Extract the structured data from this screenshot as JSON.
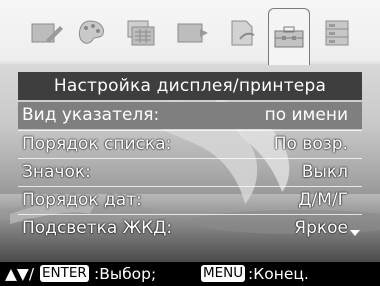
{
  "menu": {
    "title": "Настройка дисплея/принтера",
    "items": [
      {
        "label": "Вид указателя:",
        "value": "по имени"
      },
      {
        "label": "Порядок списка:",
        "value": "По возр."
      },
      {
        "label": "Значок:",
        "value": "Выкл"
      },
      {
        "label": "Порядок дат:",
        "value": "Д/М/Г"
      },
      {
        "label": "Подсветка ЖКД:",
        "value": "Яркое"
      }
    ],
    "selected_index": 0
  },
  "footer": {
    "arrows": "▲▼/",
    "enter_key": "ENTER",
    "enter_action": ":Выбор;",
    "menu_key": "MENU",
    "menu_action": ":Конец."
  },
  "tabs": [
    "edit-icon",
    "palette-icon",
    "calendar-icon",
    "slideshow-icon",
    "file-edit-icon",
    "toolbox-icon",
    "list-icon"
  ],
  "colors": {
    "title_bg": "#3e3e3e",
    "selection_bg": "#7f7f7f",
    "footer_bg": "#000000"
  }
}
